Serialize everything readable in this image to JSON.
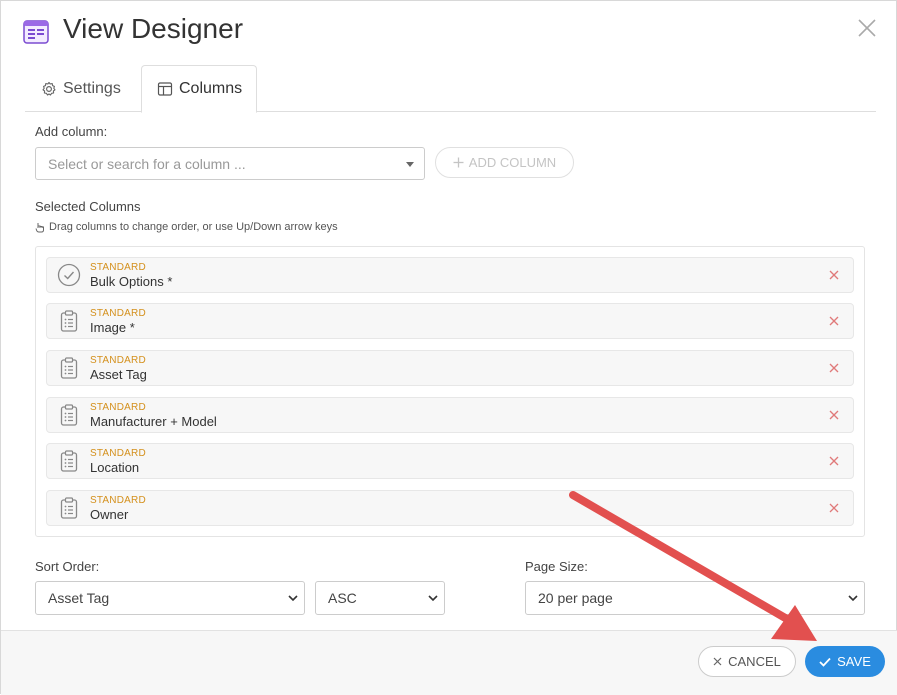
{
  "dialog": {
    "title": "View Designer",
    "tabs": [
      {
        "label": "Settings",
        "icon": "gear-icon"
      },
      {
        "label": "Columns",
        "icon": "columns-icon"
      }
    ]
  },
  "add_column": {
    "label": "Add column:",
    "placeholder": "Select or search for a column ...",
    "button_label": "ADD COLUMN"
  },
  "selected_columns": {
    "label": "Selected Columns",
    "hint": "Drag columns to change order, or use Up/Down arrow keys",
    "items": [
      {
        "type": "STANDARD",
        "name": "Bulk Options *",
        "icon": "check-circle-icon"
      },
      {
        "type": "STANDARD",
        "name": "Image *",
        "icon": "clipboard-list-icon"
      },
      {
        "type": "STANDARD",
        "name": "Asset Tag",
        "icon": "clipboard-list-icon"
      },
      {
        "type": "STANDARD",
        "name": "Manufacturer + Model",
        "icon": "clipboard-list-icon"
      },
      {
        "type": "STANDARD",
        "name": "Location",
        "icon": "clipboard-list-icon"
      },
      {
        "type": "STANDARD",
        "name": "Owner",
        "icon": "clipboard-list-icon"
      }
    ]
  },
  "sort": {
    "label": "Sort Order:",
    "field_value": "Asset Tag",
    "direction_value": "ASC"
  },
  "page_size": {
    "label": "Page Size:",
    "value": "20 per page"
  },
  "footer": {
    "cancel_label": "CANCEL",
    "save_label": "SAVE"
  },
  "colors": {
    "accent": "#2a8ce0",
    "type_label": "#d4901c",
    "remove_x": "#e07a7a",
    "annotation_arrow": "#e2504f"
  }
}
